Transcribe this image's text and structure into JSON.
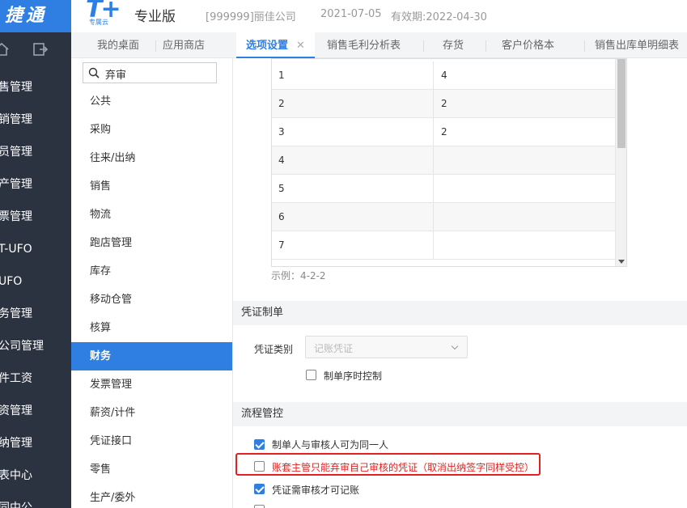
{
  "header": {
    "brand": "捷通",
    "product_logo": "T+",
    "product_sub": "专属云",
    "edition": "专业版",
    "company": "[999999]丽佳公司",
    "date": "2021-07-05",
    "validity": "有效期:2022-04-30",
    "brand_color": "#2f7fe3"
  },
  "sidebar": {
    "icons": [
      "home-icon",
      "export-icon"
    ],
    "items": [
      "售管理",
      "销管理",
      "员管理",
      "产管理",
      "票管理",
      "T-UFO",
      "UFO",
      "务管理",
      "公司管理",
      "件工资",
      "资管理",
      "纳管理",
      "表中心",
      "同中公"
    ]
  },
  "tabs": [
    {
      "label": "我的桌面"
    },
    {
      "label": "应用商店"
    },
    {
      "label": "选项设置",
      "active": true,
      "close": "✕"
    },
    {
      "label": "销售毛利分析表"
    },
    {
      "label": "存货"
    },
    {
      "label": "客户价格本"
    },
    {
      "label": "销售出库单明细表"
    }
  ],
  "search": {
    "value": "弃审"
  },
  "categories": [
    "公共",
    "采购",
    "往来/出纳",
    "销售",
    "物流",
    "跑店管理",
    "库存",
    "移动仓管",
    "核算",
    "财务",
    "发票管理",
    "薪资/计件",
    "凭证接口",
    "零售",
    "生产/委外"
  ],
  "active_category": "财务",
  "grid": {
    "rows": [
      [
        "1",
        "4"
      ],
      [
        "2",
        "2"
      ],
      [
        "3",
        "2"
      ],
      [
        "4",
        ""
      ],
      [
        "5",
        ""
      ],
      [
        "6",
        ""
      ],
      [
        "7",
        ""
      ]
    ],
    "example": "示例：4-2-2"
  },
  "voucher": {
    "title": "凭证制单",
    "type_label": "凭证类别",
    "type_value": "记账凭证",
    "seq_control": "制单序时控制",
    "seq_checked": false
  },
  "flow": {
    "title": "流程管控",
    "options": [
      {
        "label": "制单人与审核人可为同一人",
        "checked": true
      },
      {
        "label": "账套主管只能弃审自己审核的凭证（取消出纳签字同样受控）",
        "checked": false,
        "highlight": true
      },
      {
        "label": "凭证需审核才可记账",
        "checked": true
      }
    ]
  }
}
